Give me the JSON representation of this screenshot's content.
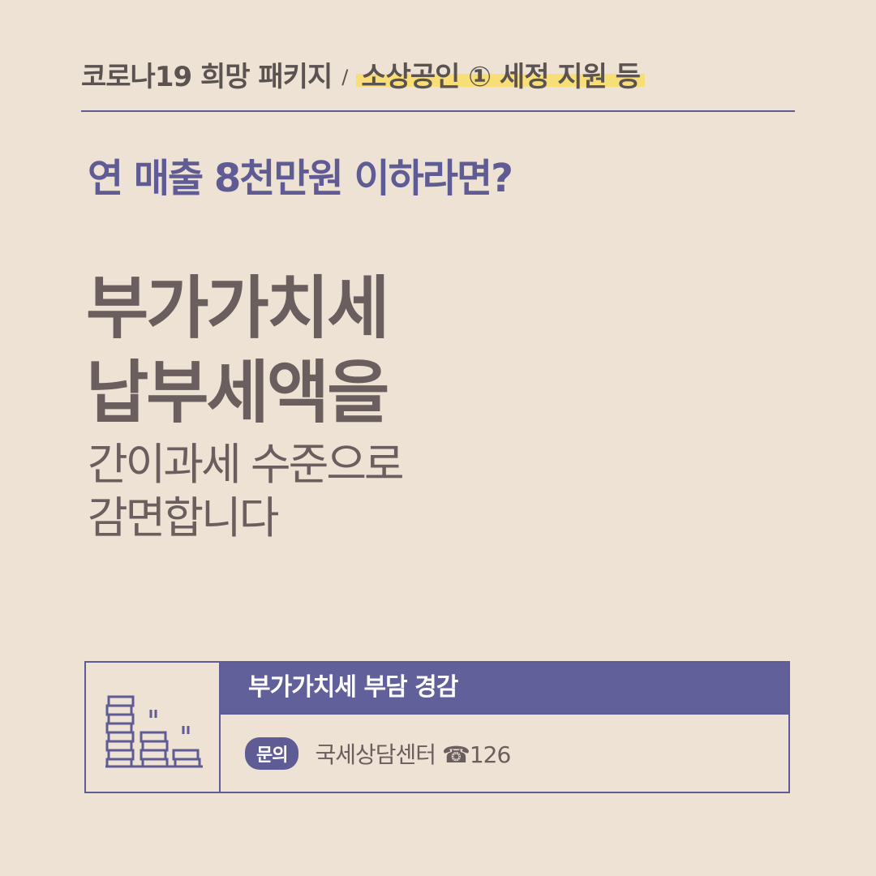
{
  "header": {
    "category": "코로나19 희망 패키지",
    "separator": "/",
    "topic": "소상공인 ① 세정 지원 등"
  },
  "question": "연 매출 8천만원 이하라면?",
  "headline": {
    "line1": "부가가치세",
    "line2": "납부세액을"
  },
  "subline": {
    "line1": "간이과세 수준으로",
    "line2": "감면합니다"
  },
  "infobox": {
    "icon": "coin-stacks-icon",
    "title": "부가가치세 부담 경감",
    "badge": "문의",
    "contact": "국세상담센터 ☎126"
  },
  "colors": {
    "background": "#EDE2D3",
    "accent": "#5F5C95",
    "highlight": "#F8DE77",
    "text": "#6A5E5E"
  }
}
